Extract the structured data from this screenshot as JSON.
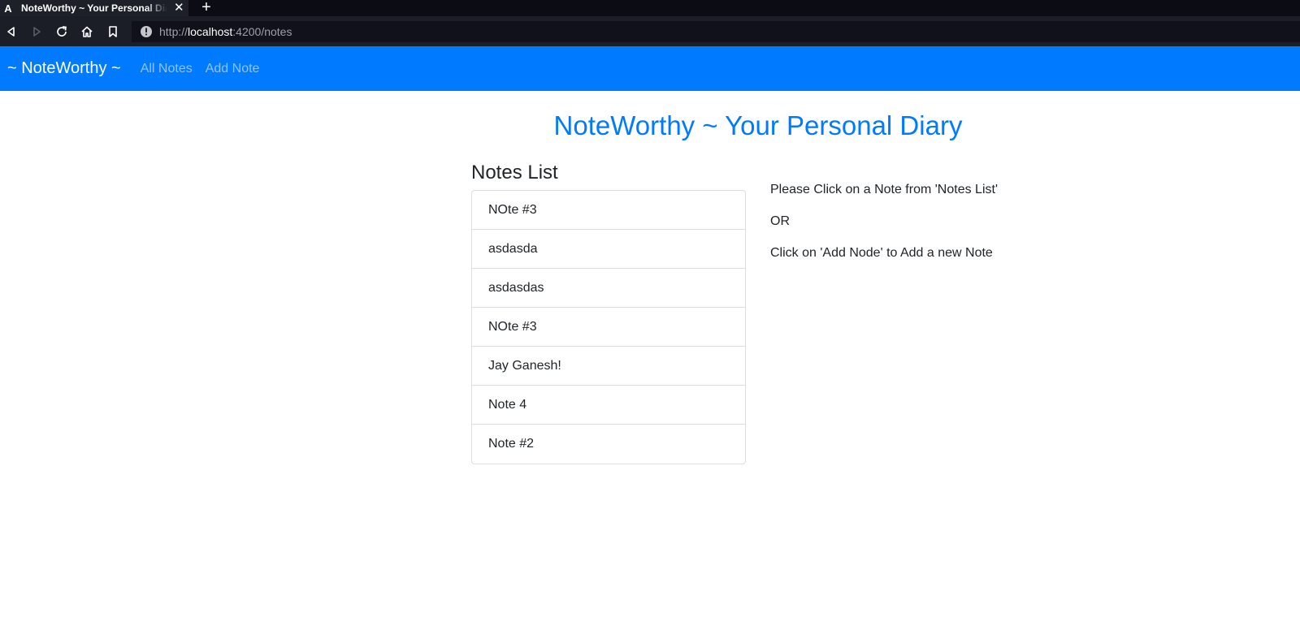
{
  "browser": {
    "tab_title": "NoteWorthy ~ Your Personal Diary",
    "tab_favicon": "A",
    "close_glyph": "✕",
    "new_tab_glyph": "+",
    "url_scheme": "http://",
    "url_host": "localhost",
    "url_rest": ":4200/notes",
    "icons": [
      "back-icon",
      "forward-icon",
      "reload-icon",
      "home-icon",
      "bookmark-icon",
      "info-icon"
    ]
  },
  "app_nav": {
    "brand": "~ NoteWorthy ~",
    "links": [
      {
        "label": "All Notes"
      },
      {
        "label": "Add Note"
      }
    ]
  },
  "main": {
    "title": "NoteWorthy ~ Your Personal Diary",
    "list_heading": "Notes List",
    "notes": [
      {
        "title": "NOte #3"
      },
      {
        "title": "asdasda"
      },
      {
        "title": "asdasdas"
      },
      {
        "title": "NOte #3"
      },
      {
        "title": "Jay Ganesh!"
      },
      {
        "title": "Note 4"
      },
      {
        "title": "Note #2"
      }
    ],
    "hint": {
      "line1": "Please Click on a Note from 'Notes List'",
      "line2": "OR",
      "line3": "Click on 'Add Node' to Add a new Note"
    }
  },
  "colors": {
    "primary": "#007bff",
    "text": "#212529",
    "browser_dark": "#1c1e27"
  }
}
